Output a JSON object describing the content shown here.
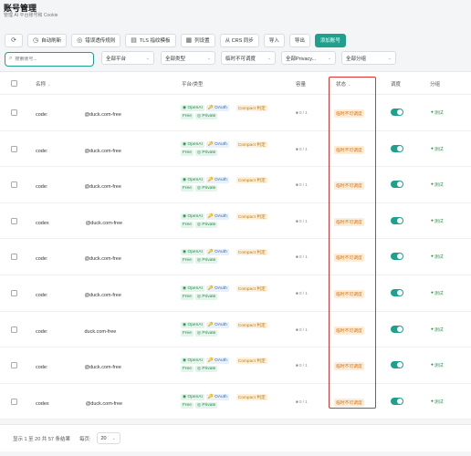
{
  "header": {
    "title": "账号管理",
    "subtitle": "管理 AI 平台账号和 Cookie"
  },
  "toolbar": {
    "buttons": [
      {
        "icon": "refresh-icon",
        "label": ""
      },
      {
        "icon": "clock-icon",
        "label": "自动刷新"
      },
      {
        "icon": "check-circle-icon",
        "label": "错误透传规则"
      },
      {
        "icon": "doc-icon",
        "label": "TLS 指纹模板"
      },
      {
        "icon": "columns-icon",
        "label": "列设置"
      },
      {
        "icon": "",
        "label": "从 CRS 同步"
      },
      {
        "icon": "",
        "label": "导入"
      },
      {
        "icon": "",
        "label": "导出"
      },
      {
        "icon": "",
        "label": "添加账号"
      }
    ]
  },
  "filters": {
    "search_placeholder": "搜索账号...",
    "selects": [
      "全部平台",
      "全部类型",
      "临时不可调度",
      "全部Privacy...",
      "全部分组"
    ]
  },
  "table": {
    "headers": {
      "name": "名称",
      "platform": "平台/类型",
      "capacity": "容量",
      "status": "状态",
      "schedule": "调度",
      "group": "分组"
    },
    "rows": [
      {
        "name_prefix": "code:",
        "name_suffix": "@duck.com-free",
        "platform": "OpenAI",
        "auth": "OAuth",
        "plan": "Free",
        "privacy": "Private",
        "compact": "Compact 判定",
        "capacity": "■ 0 / 1",
        "status": "临时不可调度",
        "group": "测试"
      },
      {
        "name_prefix": "code:",
        "name_suffix": "@duck.com-free",
        "platform": "OpenAI",
        "auth": "OAuth",
        "plan": "Free",
        "privacy": "Private",
        "compact": "Compact 判定",
        "capacity": "■ 0 / 1",
        "status": "临时不可调度",
        "group": "测试"
      },
      {
        "name_prefix": "code:",
        "name_suffix": "@duck.com-free",
        "platform": "OpenAI",
        "auth": "OAuth",
        "plan": "Free",
        "privacy": "Private",
        "compact": "Compact 判定",
        "capacity": "■ 0 / 1",
        "status": "临时不可调度",
        "group": "测试"
      },
      {
        "name_prefix": "codex",
        "name_suffix": "@duck.com-free",
        "platform": "OpenAI",
        "auth": "OAuth",
        "plan": "Free",
        "privacy": "Private",
        "compact": "Compact 判定",
        "capacity": "■ 0 / 1",
        "status": "临时不可调度",
        "group": "测试"
      },
      {
        "name_prefix": "code:",
        "name_suffix": "@duck.com-free",
        "platform": "OpenAI",
        "auth": "OAuth",
        "plan": "Free",
        "privacy": "Private",
        "compact": "Compact 判定",
        "capacity": "■ 0 / 1",
        "status": "临时不可调度",
        "group": "测试"
      },
      {
        "name_prefix": "code:",
        "name_suffix": "@duck.com-free",
        "platform": "OpenAI",
        "auth": "OAuth",
        "plan": "Free",
        "privacy": "Private",
        "compact": "Compact 判定",
        "capacity": "■ 0 / 1",
        "status": "临时不可调度",
        "group": "测试"
      },
      {
        "name_prefix": "code:",
        "name_suffix": "duck.com-free",
        "platform": "OpenAI",
        "auth": "OAuth",
        "plan": "Free",
        "privacy": "Private",
        "compact": "Compact 判定",
        "capacity": "■ 0 / 1",
        "status": "临时不可调度",
        "group": "测试"
      },
      {
        "name_prefix": "code:",
        "name_suffix": "@duck.com-free",
        "platform": "OpenAI",
        "auth": "OAuth",
        "plan": "Free",
        "privacy": "Private",
        "compact": "Compact 判定",
        "capacity": "■ 0 / 1",
        "status": "临时不可调度",
        "group": "测试"
      },
      {
        "name_prefix": "codex",
        "name_suffix": "@duck.com-free",
        "platform": "OpenAI",
        "auth": "OAuth",
        "plan": "Free",
        "privacy": "Private",
        "compact": "Compact 判定",
        "capacity": "■ 0 / 1",
        "status": "临时不可调度",
        "group": "测试"
      }
    ]
  },
  "footer": {
    "summary": "显示 1 至 20 共 57 条结果",
    "per_page_label": "每页:",
    "per_page_value": "20"
  },
  "colors": {
    "accent": "#1fa08c",
    "status_warn": "#d9730d",
    "highlight": "#e03131"
  }
}
